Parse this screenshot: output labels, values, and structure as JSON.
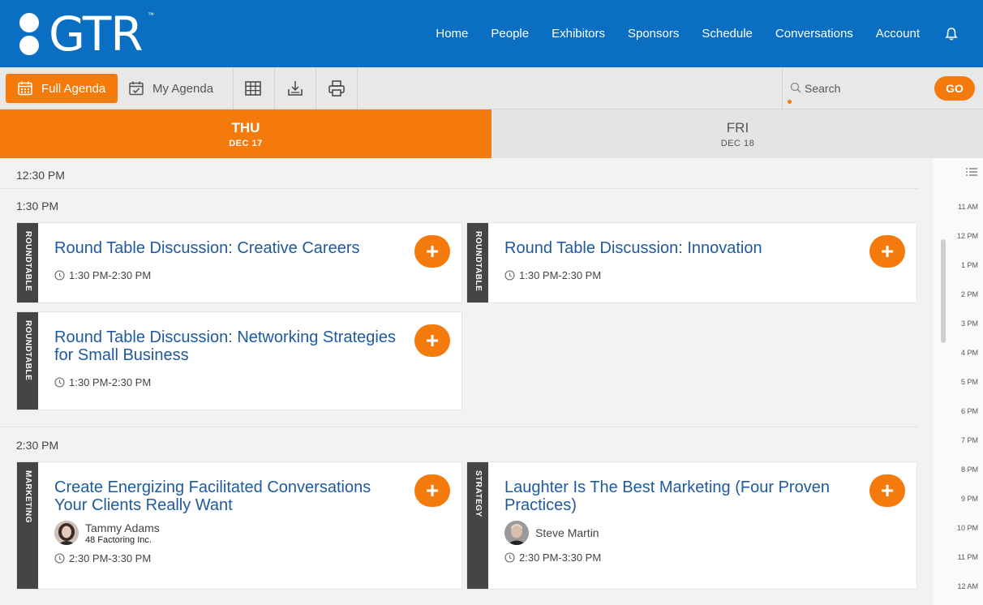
{
  "header": {
    "logo_text": "GTR",
    "logo_tm": "™",
    "nav": [
      "Home",
      "People",
      "Exhibitors",
      "Sponsors",
      "Schedule",
      "Conversations",
      "Account"
    ]
  },
  "toolbar": {
    "full_agenda": "Full Agenda",
    "my_agenda": "My Agenda",
    "search_placeholder": "Search",
    "go": "GO"
  },
  "days": [
    {
      "name": "THU",
      "date": "DEC 17"
    },
    {
      "name": "FRI",
      "date": "DEC 18"
    }
  ],
  "schedule": {
    "times": [
      "12:30 PM",
      "1:30 PM",
      "2:30 PM"
    ],
    "sessions": [
      {
        "tag": "ROUNDTABLE",
        "title": "Round Table Discussion: Creative Careers",
        "time": "1:30 PM-2:30 PM"
      },
      {
        "tag": "ROUNDTABLE",
        "title": "Round Table Discussion: Innovation",
        "time": "1:30 PM-2:30 PM"
      },
      {
        "tag": "ROUNDTABLE",
        "title_line1": "Round Table Discussion: Networking Strategies",
        "title_line2": "for Small Business",
        "time": "1:30 PM-2:30 PM"
      },
      {
        "tag": "MARKETING",
        "title_line1": "Create Energizing Facilitated Conversations",
        "title_line2": "Your Clients Really Want",
        "speaker": "Tammy Adams",
        "org": "48 Factoring Inc.",
        "time": "2:30 PM-3:30 PM"
      },
      {
        "tag": "STRATEGY",
        "title_line1": "Laughter Is The Best Marketing (Four Proven",
        "title_line2": "Practices)",
        "speaker": "Steve Martin",
        "time": "2:30 PM-3:30 PM"
      }
    ],
    "add_symbol": "+"
  },
  "timeline": [
    "11 AM",
    "12 PM",
    "1 PM",
    "2 PM",
    "3 PM",
    "4 PM",
    "5 PM",
    "6 PM",
    "7 PM",
    "8 PM",
    "9 PM",
    "10 PM",
    "11 PM",
    "12 AM"
  ],
  "colors": {
    "brand_blue": "#0a6fc2",
    "accent_orange": "#f47a0b",
    "title_blue": "#1f5a9e",
    "tag_dark": "#454545"
  }
}
